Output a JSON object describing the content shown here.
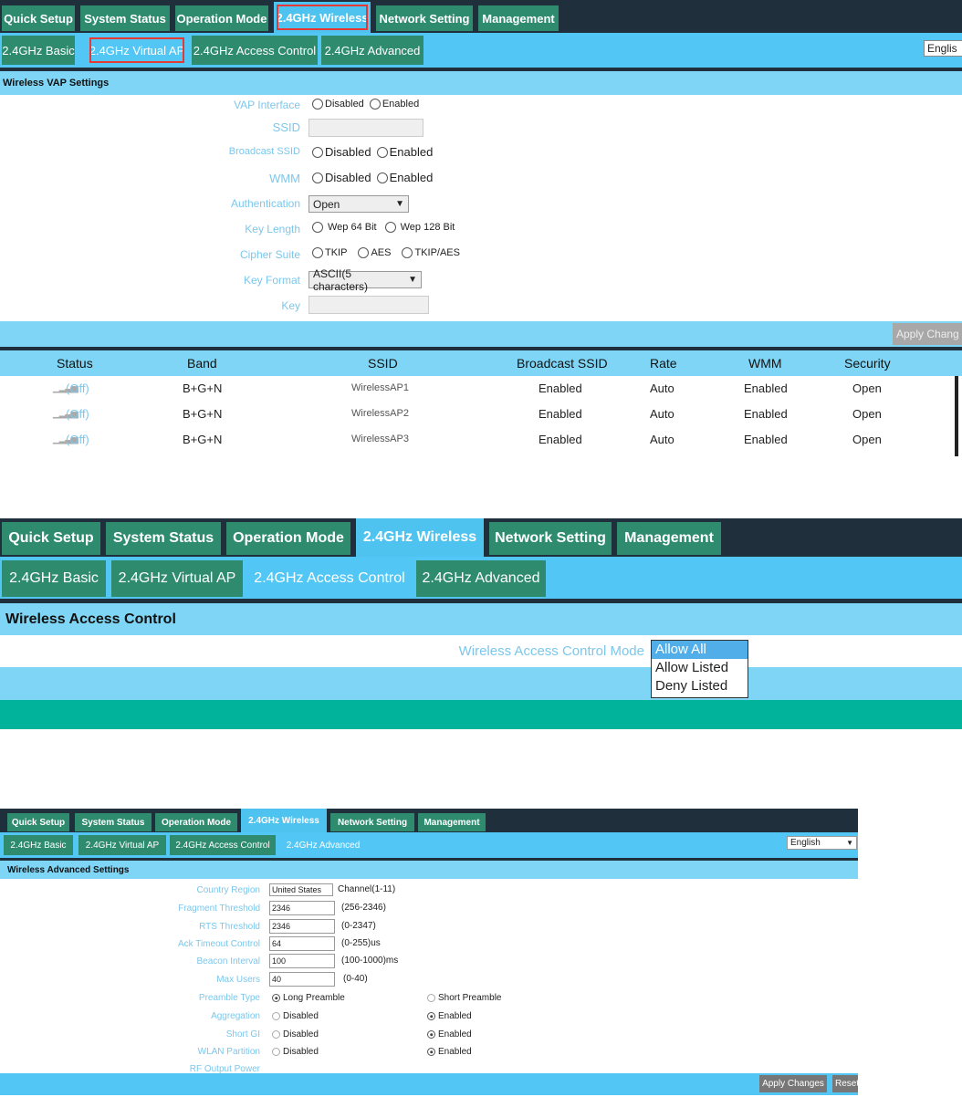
{
  "nav": {
    "top_tabs": [
      "Quick Setup",
      "System Status",
      "Operation Mode",
      "2.4GHz Wireless",
      "Network Setting",
      "Management"
    ],
    "sub_tabs": [
      "2.4GHz Basic",
      "2.4GHz Virtual AP",
      "2.4GHz Access Control",
      "2.4GHz Advanced"
    ],
    "language": "English",
    "language_clipped": "Englis"
  },
  "vap": {
    "section_title": "Wireless VAP Settings",
    "labels": {
      "vap_interface": "VAP Interface",
      "ssid": "SSID",
      "broadcast_ssid": "Broadcast SSID",
      "wmm": "WMM",
      "authentication": "Authentication",
      "key_length": "Key Length",
      "cipher_suite": "Cipher Suite",
      "key_format": "Key Format",
      "key": "Key"
    },
    "options": {
      "disabled": "Disabled",
      "enabled": "Enabled",
      "authentication": "Open",
      "wep64": "Wep 64 Bit",
      "wep128": "Wep 128 Bit",
      "tkip": "TKIP",
      "aes": "AES",
      "tkip_aes": "TKIP/AES",
      "key_format": "ASCII(5 characters)"
    },
    "apply_button": "Apply Chang",
    "table": {
      "headers": [
        "Status",
        "Band",
        "SSID",
        "Broadcast SSID",
        "Rate",
        "WMM",
        "Security"
      ],
      "rows": [
        {
          "status": "(Off)",
          "band": "B+G+N",
          "ssid": "WirelessAP1",
          "broadcast": "Enabled",
          "rate": "Auto",
          "wmm": "Enabled",
          "security": "Open"
        },
        {
          "status": "(Off)",
          "band": "B+G+N",
          "ssid": "WirelessAP2",
          "broadcast": "Enabled",
          "rate": "Auto",
          "wmm": "Enabled",
          "security": "Open"
        },
        {
          "status": "(Off)",
          "band": "B+G+N",
          "ssid": "WirelessAP3",
          "broadcast": "Enabled",
          "rate": "Auto",
          "wmm": "Enabled",
          "security": "Open"
        }
      ]
    }
  },
  "access_control": {
    "section_title": "Wireless Access Control",
    "mode_label": "Wireless Access Control Mode",
    "options": [
      "Allow All",
      "Allow Listed",
      "Deny Listed"
    ],
    "selected": "Allow All"
  },
  "advanced": {
    "section_title": "Wireless Advanced Settings",
    "labels": {
      "country": "Country Region",
      "fragment": "Fragment Threshold",
      "rts": "RTS Threshold",
      "ack": "Ack Timeout Control",
      "beacon": "Beacon Interval",
      "max_users": "Max Users",
      "preamble": "Preamble Type",
      "aggregation": "Aggregation",
      "short_gi": "Short GI",
      "wlan_partition": "WLAN Partition",
      "rf_power": "RF Output Power"
    },
    "values": {
      "country": "United States",
      "country_hint": "Channel(1-11)",
      "fragment": "2346",
      "fragment_hint": "(256-2346)",
      "rts": "2346",
      "rts_hint": "(0-2347)",
      "ack": "64",
      "ack_hint": "(0-255)us",
      "beacon": "100",
      "beacon_hint": "(100-1000)ms",
      "max_users": "40",
      "max_users_hint": "(0-40)",
      "long_preamble": "Long Preamble",
      "short_preamble": "Short Preamble",
      "disabled": "Disabled",
      "enabled": "Enabled"
    },
    "apply_button": "Apply Changes",
    "reset_button": "Reset"
  }
}
